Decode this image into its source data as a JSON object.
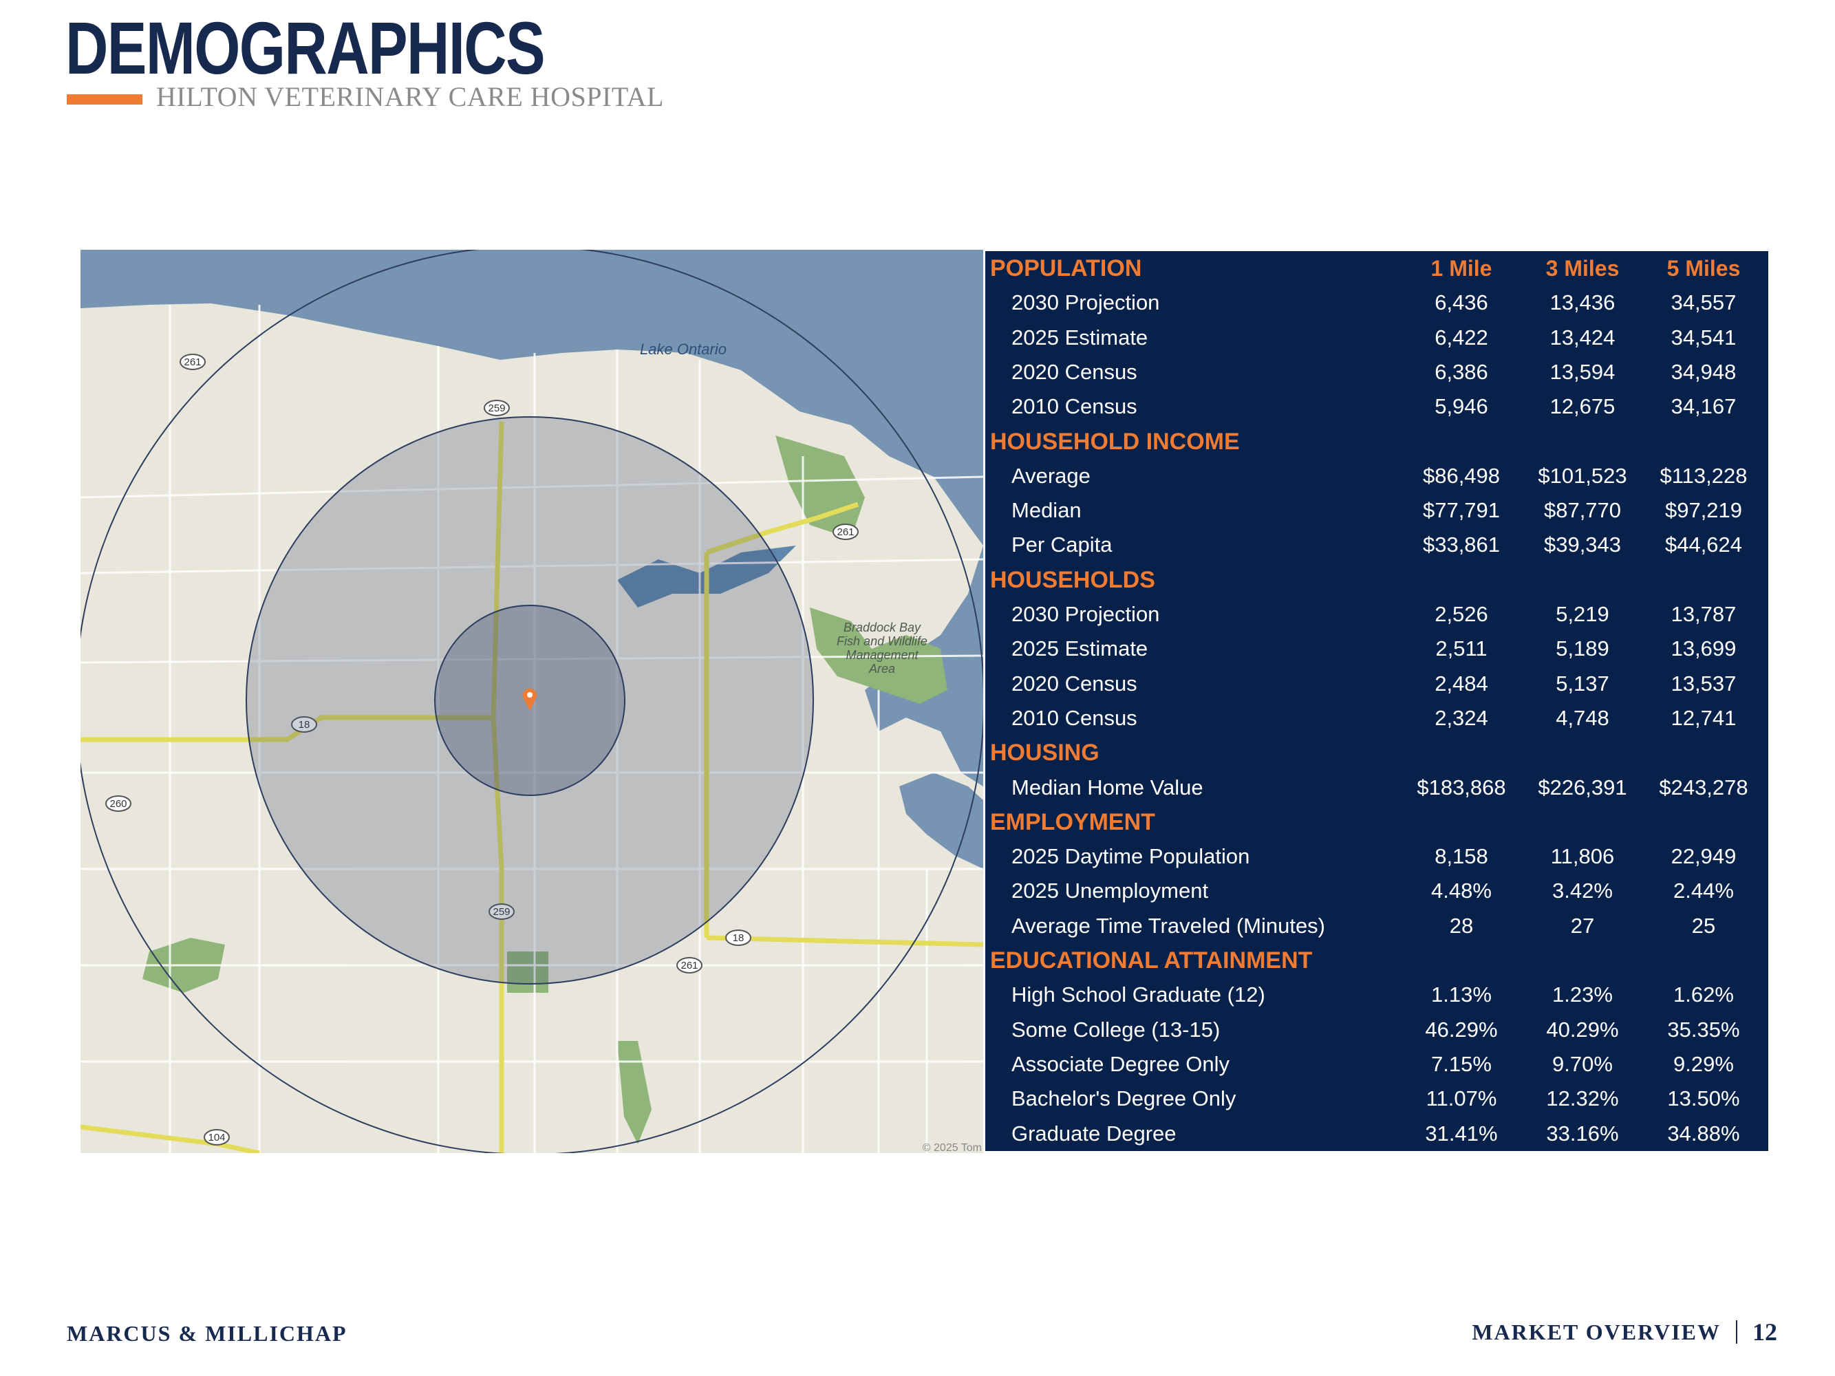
{
  "header": {
    "title": "DEMOGRAPHICS",
    "subtitle": "HILTON VETERINARY CARE HOSPITAL",
    "accent_color": "#f07c33",
    "title_color": "#17294e"
  },
  "map": {
    "water_label": "Lake Ontario",
    "area_label_lines": [
      "Braddock Bay",
      "Fish and Wildlife",
      "Management",
      "Area"
    ],
    "route_labels": [
      "261",
      "259",
      "261",
      "18",
      "260",
      "259",
      "18",
      "261",
      "104"
    ],
    "copyright": "© 2025 Tom",
    "marker_icon": "map-pin-icon",
    "radius_rings": [
      "1 Mile",
      "3 Miles",
      "5 Miles"
    ]
  },
  "table": {
    "columns": [
      "1 Mile",
      "3 Miles",
      "5 Miles"
    ],
    "sections": [
      {
        "title": "POPULATION",
        "show_columns": true,
        "rows": [
          {
            "label": "2030 Projection",
            "values": [
              "6,436",
              "13,436",
              "34,557"
            ]
          },
          {
            "label": "2025 Estimate",
            "values": [
              "6,422",
              "13,424",
              "34,541"
            ]
          },
          {
            "label": "2020 Census",
            "values": [
              "6,386",
              "13,594",
              "34,948"
            ]
          },
          {
            "label": "2010 Census",
            "values": [
              "5,946",
              "12,675",
              "34,167"
            ]
          }
        ]
      },
      {
        "title": "HOUSEHOLD INCOME",
        "rows": [
          {
            "label": "Average",
            "values": [
              "$86,498",
              "$101,523",
              "$113,228"
            ]
          },
          {
            "label": "Median",
            "values": [
              "$77,791",
              "$87,770",
              "$97,219"
            ]
          },
          {
            "label": "Per Capita",
            "values": [
              "$33,861",
              "$39,343",
              "$44,624"
            ]
          }
        ]
      },
      {
        "title": "HOUSEHOLDS",
        "rows": [
          {
            "label": "2030 Projection",
            "values": [
              "2,526",
              "5,219",
              "13,787"
            ]
          },
          {
            "label": "2025 Estimate",
            "values": [
              "2,511",
              "5,189",
              "13,699"
            ]
          },
          {
            "label": "2020 Census",
            "values": [
              "2,484",
              "5,137",
              "13,537"
            ]
          },
          {
            "label": "2010 Census",
            "values": [
              "2,324",
              "4,748",
              "12,741"
            ]
          }
        ]
      },
      {
        "title": "HOUSING",
        "rows": [
          {
            "label": "Median Home Value",
            "values": [
              "$183,868",
              "$226,391",
              "$243,278"
            ]
          }
        ]
      },
      {
        "title": "EMPLOYMENT",
        "rows": [
          {
            "label": "2025 Daytime Population",
            "values": [
              "8,158",
              "11,806",
              "22,949"
            ]
          },
          {
            "label": "2025 Unemployment",
            "values": [
              "4.48%",
              "3.42%",
              "2.44%"
            ]
          },
          {
            "label": "Average Time Traveled (Minutes)",
            "values": [
              "28",
              "27",
              "25"
            ]
          }
        ]
      },
      {
        "title": "EDUCATIONAL ATTAINMENT",
        "rows": [
          {
            "label": "High School Graduate (12)",
            "values": [
              "1.13%",
              "1.23%",
              "1.62%"
            ]
          },
          {
            "label": "Some College (13-15)",
            "values": [
              "46.29%",
              "40.29%",
              "35.35%"
            ]
          },
          {
            "label": "Associate Degree Only",
            "values": [
              "7.15%",
              "9.70%",
              "9.29%"
            ]
          },
          {
            "label": "Bachelor's Degree Only",
            "values": [
              "11.07%",
              "12.32%",
              "13.50%"
            ]
          },
          {
            "label": "Graduate Degree",
            "values": [
              "31.41%",
              "33.16%",
              "34.88%"
            ]
          }
        ]
      }
    ]
  },
  "footer": {
    "brand": "MARCUS & MILLICHAP",
    "section": "MARKET OVERVIEW",
    "page": "12"
  }
}
